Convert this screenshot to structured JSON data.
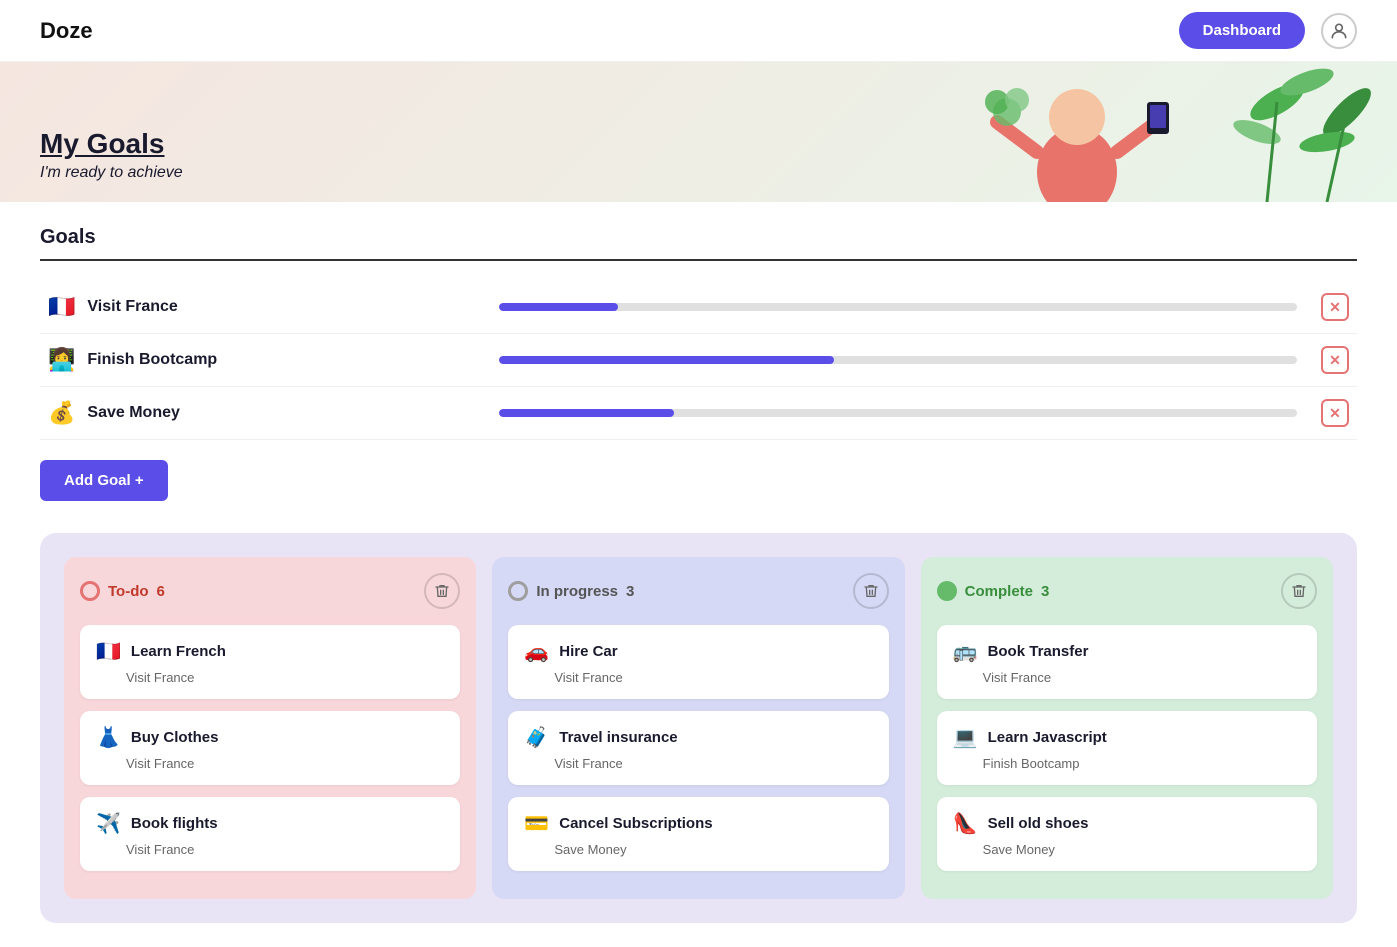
{
  "navbar": {
    "logo": "Doze",
    "dashboard_btn": "Dashboard"
  },
  "hero": {
    "title": "My Goals",
    "subtitle": "I'm ready to achieve"
  },
  "goals_section": {
    "title": "Goals",
    "goals": [
      {
        "id": "goal-visit-france",
        "emoji": "🇫🇷",
        "name": "Visit France",
        "progress": 15
      },
      {
        "id": "goal-finish-bootcamp",
        "emoji": "👩‍💻",
        "name": "Finish Bootcamp",
        "progress": 42
      },
      {
        "id": "goal-save-money",
        "emoji": "💰",
        "name": "Save Money",
        "progress": 22
      }
    ],
    "add_btn": "Add Goal +"
  },
  "kanban": {
    "columns": [
      {
        "id": "todo",
        "title": "To-do",
        "count": 6,
        "status": "todo",
        "tasks": [
          {
            "icon": "🇫🇷",
            "title": "Learn French",
            "subtitle": "Visit France"
          },
          {
            "icon": "👗",
            "title": "Buy Clothes",
            "subtitle": "Visit France"
          },
          {
            "icon": "✈️",
            "title": "Book flights",
            "subtitle": "Visit France"
          }
        ]
      },
      {
        "id": "inprogress",
        "title": "In progress",
        "count": 3,
        "status": "inprogress",
        "tasks": [
          {
            "icon": "🚗",
            "title": "Hire Car",
            "subtitle": "Visit France"
          },
          {
            "icon": "🧳",
            "title": "Travel insurance",
            "subtitle": "Visit France"
          },
          {
            "icon": "💳",
            "title": "Cancel Subscriptions",
            "subtitle": "Save Money"
          }
        ]
      },
      {
        "id": "complete",
        "title": "Complete",
        "count": 3,
        "status": "complete",
        "tasks": [
          {
            "icon": "🚌",
            "title": "Book Transfer",
            "subtitle": "Visit France"
          },
          {
            "icon": "💻",
            "title": "Learn Javascript",
            "subtitle": "Finish Bootcamp"
          },
          {
            "icon": "👠",
            "title": "Sell old shoes",
            "subtitle": "Save Money"
          }
        ]
      }
    ]
  }
}
